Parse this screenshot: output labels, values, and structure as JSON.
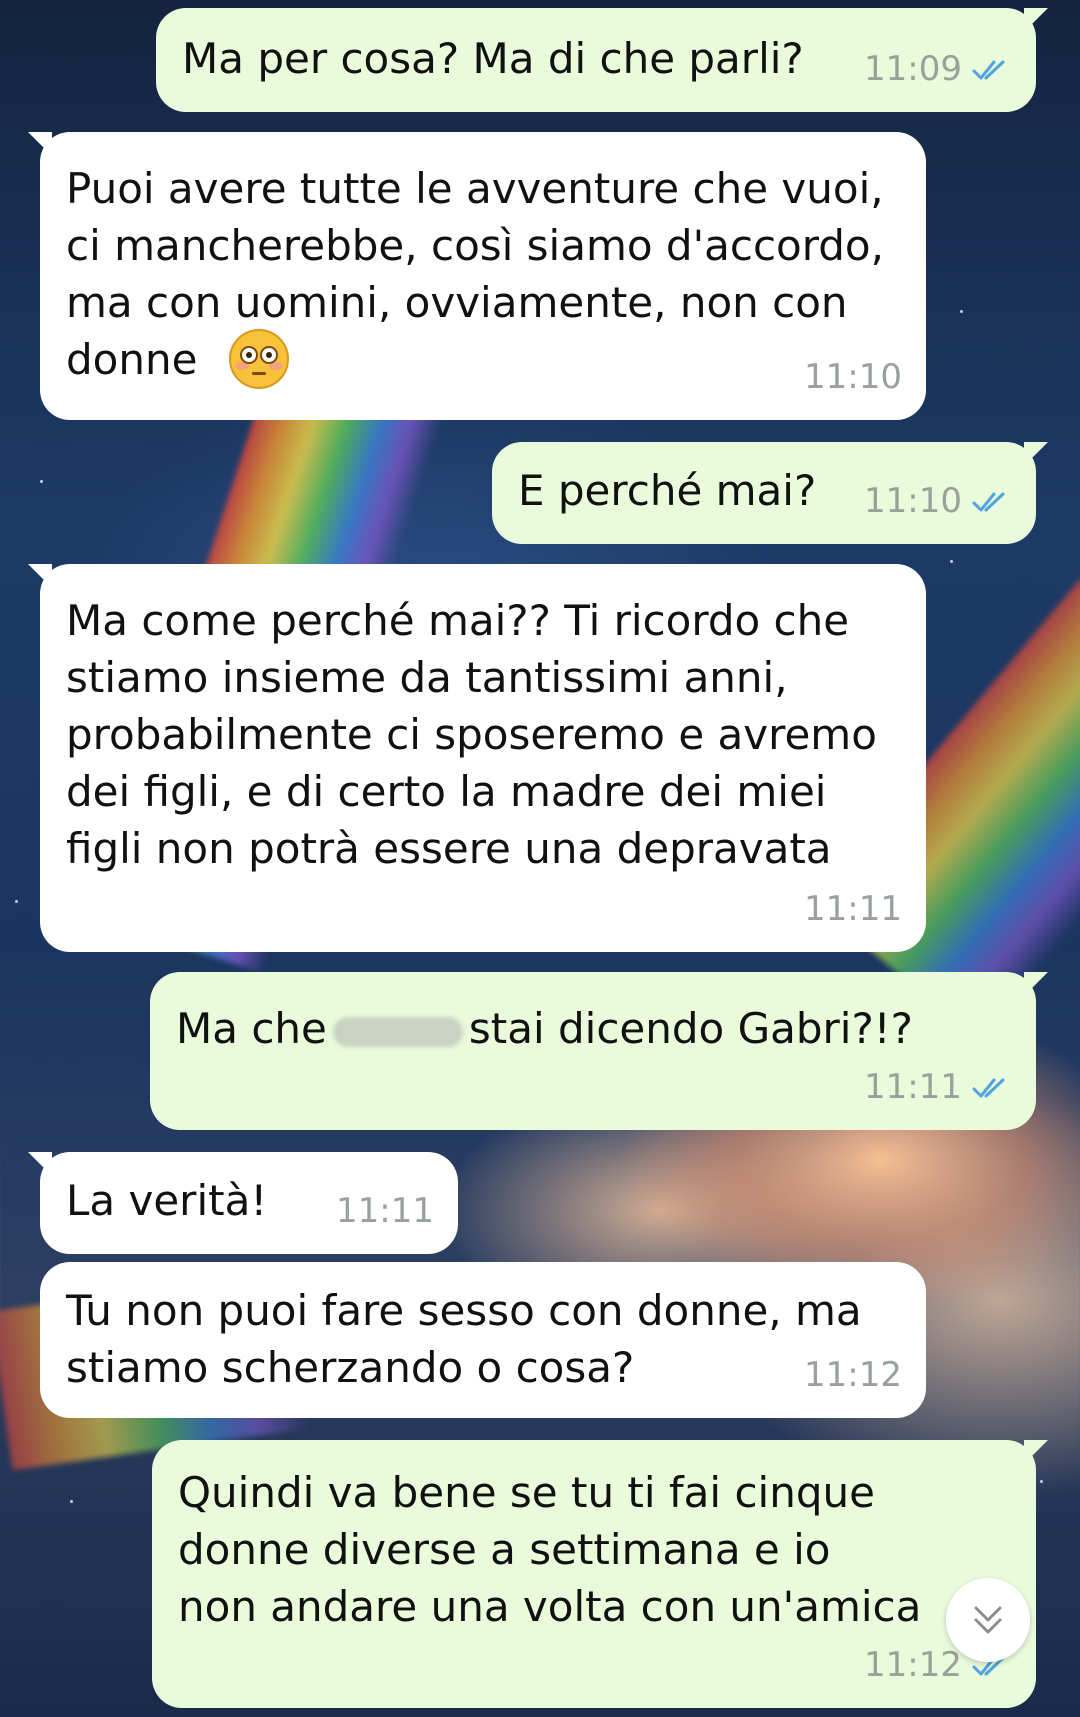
{
  "colors": {
    "incoming_bubble": "#ffffff",
    "outgoing_bubble": "#e9fbdb",
    "timestamp": "#9aa09a",
    "read_ticks": "#4fa3e0"
  },
  "messages": [
    {
      "direction": "out",
      "text": "Ma per cosa? Ma di che parli?",
      "time": "11:09",
      "status_icon": "double-check-read-icon"
    },
    {
      "direction": "in",
      "text": "Puoi avere tutte le avventure che vuoi,\nci mancherebbe, così siamo d'accordo,\nma con uomini, ovviamente, non con\ndonne",
      "emoji": "flushed-face-emoji",
      "time": "11:10"
    },
    {
      "direction": "out",
      "text": "E perché mai?",
      "time": "11:10",
      "status_icon": "double-check-read-icon"
    },
    {
      "direction": "in",
      "text": "Ma come perché mai?? Ti ricordo che\nstiamo insieme da tantissimi anni,\nprobabilmente ci sposeremo e avremo\ndei figli, e di certo la madre dei miei\nfigli non potrà essere una depravata",
      "time": "11:11"
    },
    {
      "direction": "out",
      "text_before": "Ma che",
      "text_after": "stai dicendo Gabri?!?",
      "censored": true,
      "time": "11:11",
      "status_icon": "double-check-read-icon"
    },
    {
      "direction": "in",
      "text": "La verità!",
      "time": "11:11"
    },
    {
      "direction": "in",
      "text": "Tu non puoi fare sesso con donne, ma\nstiamo scherzando o cosa?",
      "time": "11:12"
    },
    {
      "direction": "out",
      "text": "Quindi va bene se tu ti fai cinque\ndonne diverse a settimana e io\nnon andare una volta con un'amica",
      "time": "11:12",
      "status_icon": "double-check-read-icon"
    }
  ],
  "scroll_button_icon": "double-chevron-down-icon"
}
